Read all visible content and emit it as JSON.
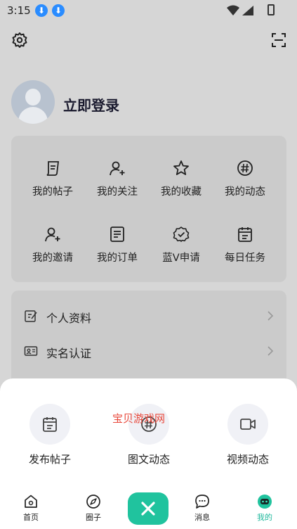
{
  "status": {
    "time": "3:15"
  },
  "profile": {
    "login_label": "立即登录"
  },
  "grid": [
    {
      "label": "我的帖子",
      "icon": "post-icon"
    },
    {
      "label": "我的关注",
      "icon": "follow-icon"
    },
    {
      "label": "我的收藏",
      "icon": "star-icon"
    },
    {
      "label": "我的动态",
      "icon": "hashtag-icon"
    },
    {
      "label": "我的邀请",
      "icon": "invite-icon"
    },
    {
      "label": "我的订单",
      "icon": "order-icon"
    },
    {
      "label": "蓝V申请",
      "icon": "verified-badge-icon"
    },
    {
      "label": "每日任务",
      "icon": "calendar-icon"
    }
  ],
  "list": [
    {
      "label": "个人资料",
      "icon": "edit-profile-icon"
    },
    {
      "label": "实名认证",
      "icon": "id-card-icon"
    }
  ],
  "sheet": {
    "actions": [
      {
        "label": "发布帖子",
        "icon": "calendar-post-icon"
      },
      {
        "label": "图文动态",
        "icon": "hashtag-icon"
      },
      {
        "label": "视频动态",
        "icon": "video-icon"
      }
    ],
    "watermark": "宝贝游戏网"
  },
  "tabs": [
    {
      "label": "首页",
      "icon": "home-icon"
    },
    {
      "label": "圈子",
      "icon": "compass-icon"
    },
    {
      "label": "消息",
      "icon": "chat-icon"
    },
    {
      "label": "我的",
      "icon": "mine-icon",
      "active": true
    }
  ],
  "colors": {
    "accent": "#20c39e",
    "watermark": "#e8473a"
  }
}
